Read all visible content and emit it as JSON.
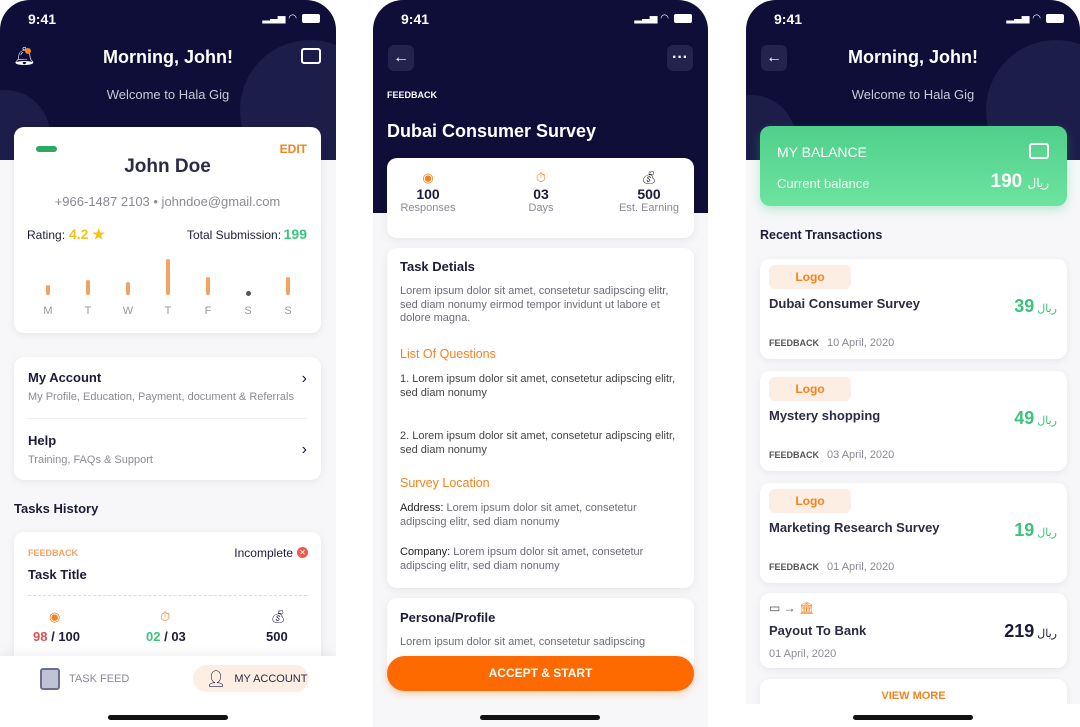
{
  "status_time": "9:41",
  "account_screen": {
    "title": "Morning, John!",
    "subtitle": "Welcome to Hala Gig",
    "profile": {
      "edit": "EDIT",
      "name": "John Doe",
      "contact": "+966-1487 2103 • johndoe@gmail.com",
      "rating_label": "Rating:",
      "rating": "4.2 ★",
      "submission_label": "Total Submission:",
      "submission": "199"
    },
    "chart_data": {
      "type": "bar",
      "categories": [
        "M",
        "T",
        "W",
        "T",
        "F",
        "S",
        "S"
      ],
      "values": [
        2,
        3,
        2.5,
        7,
        3.5,
        0,
        3.5
      ]
    },
    "menu": [
      {
        "title": "My Account",
        "sub": "My Profile, Education, Payment, document & Referrals"
      },
      {
        "title": "Help",
        "sub": "Training, FAQs & Support"
      }
    ],
    "tasks_history": "Tasks History",
    "task": {
      "category": "FEEDBACK",
      "status": "Incomplete",
      "title": "Task Title",
      "responses": "98",
      "responses_total": "/ 100",
      "days": "02",
      "days_total": "/ 03",
      "earning": "500"
    },
    "nav": {
      "task_feed": "TASK FEED",
      "my_account": "MY ACCOUNT"
    }
  },
  "survey_screen": {
    "category": "FEEDBACK",
    "title": "Dubai Consumer Survey",
    "stats": [
      {
        "value": "100",
        "label": "Responses"
      },
      {
        "value": "03",
        "label": "Days"
      },
      {
        "value": "500",
        "label": "Est. Earning"
      }
    ],
    "details_title": "Task Detials",
    "details_text": "Lorem ipsum dolor sit amet, consetetur sadipscing elitr, sed diam nonumy eirmod tempor invidunt ut labore et dolore magna.",
    "questions_title": "List Of Questions",
    "questions": [
      "1. Lorem ipsum dolor sit amet, consetetur adipscing elitr, sed diam nonumy",
      "2. Lorem ipsum dolor sit amet, consetetur adipscing elitr, sed diam nonumy"
    ],
    "location_title": "Survey Location",
    "address_label": "Address:",
    "address": " Lorem ipsum dolor sit amet, consetetur adipscing elitr, sed diam nonumy",
    "company_label": "Company:",
    "company": " Lorem ipsum dolor sit amet, consetetur adipscing elitr, sed diam nonumy",
    "persona_title": "Persona/Profile",
    "persona_text": "Lorem ipsum dolor sit amet, consetetur sadipscing",
    "accept": "ACCEPT & START"
  },
  "wallet_screen": {
    "title": "Morning, John!",
    "subtitle": "Welcome to Hala Gig",
    "balance_title": "MY BALANCE",
    "balance_label": "Current balance",
    "balance": "190",
    "currency": "ريال",
    "recent": "Recent Transactions",
    "transactions": [
      {
        "logo": "Logo",
        "name": "Dubai Consumer Survey",
        "amount": "39",
        "category": "FEEDBACK",
        "date": "10 April, 2020"
      },
      {
        "logo": "Logo",
        "name": "Mystery shopping",
        "amount": "49",
        "category": "FEEDBACK",
        "date": "03 April, 2020"
      },
      {
        "logo": "Logo",
        "name": "Marketing Research Survey",
        "amount": "19",
        "category": "FEEDBACK",
        "date": "01 April, 2020"
      }
    ],
    "payout": {
      "name": "Payout To Bank",
      "amount": "219",
      "date": "01 April, 2020"
    },
    "view_more": "VIEW MORE"
  },
  "colors": {
    "navy": "#0e0e38",
    "orange": "#f58220",
    "green": "#3cc47a",
    "accent_button": "#ff6a00"
  }
}
